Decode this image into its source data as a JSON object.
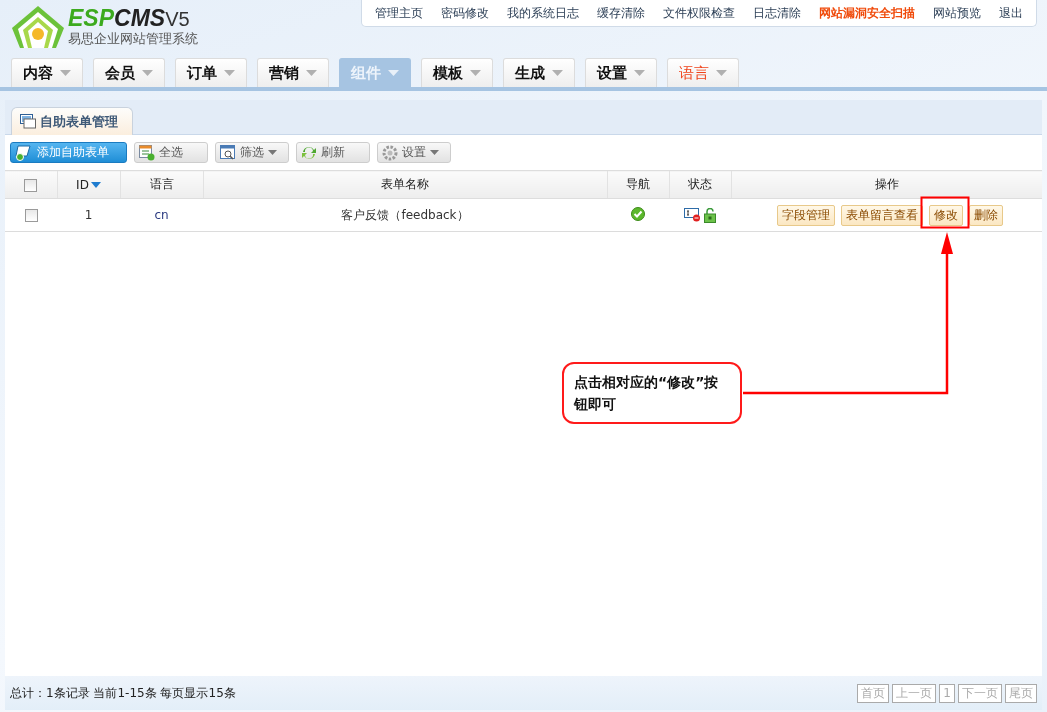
{
  "logo": {
    "brand_primary": "ESP",
    "brand_secondary": "CMS",
    "version": "V5",
    "subtitle": "易思企业网站管理系统"
  },
  "top_links": [
    {
      "label": "管理主页",
      "highlighted": false
    },
    {
      "label": "密码修改",
      "highlighted": false
    },
    {
      "label": "我的系统日志",
      "highlighted": false
    },
    {
      "label": "缓存清除",
      "highlighted": false
    },
    {
      "label": "文件权限检查",
      "highlighted": false
    },
    {
      "label": "日志清除",
      "highlighted": false
    },
    {
      "label": "网站漏洞安全扫描",
      "highlighted": true
    },
    {
      "label": "网站预览",
      "highlighted": false
    },
    {
      "label": "退出",
      "highlighted": false
    }
  ],
  "nav_tabs": [
    {
      "label": "内容",
      "selected": false,
      "highlighted": false
    },
    {
      "label": "会员",
      "selected": false,
      "highlighted": false
    },
    {
      "label": "订单",
      "selected": false,
      "highlighted": false
    },
    {
      "label": "营销",
      "selected": false,
      "highlighted": false
    },
    {
      "label": "组件",
      "selected": true,
      "highlighted": false
    },
    {
      "label": "模板",
      "selected": false,
      "highlighted": false
    },
    {
      "label": "生成",
      "selected": false,
      "highlighted": false
    },
    {
      "label": "设置",
      "selected": false,
      "highlighted": false
    },
    {
      "label": "语言",
      "selected": false,
      "highlighted": true
    }
  ],
  "panel_tab": {
    "label": "自助表单管理"
  },
  "toolbar": [
    {
      "label": "添加自助表单",
      "kind": "primary",
      "dropdown": false
    },
    {
      "label": "全选",
      "kind": "plain",
      "dropdown": false
    },
    {
      "label": "筛选",
      "kind": "plain",
      "dropdown": true
    },
    {
      "label": "刷新",
      "kind": "plain",
      "dropdown": false
    },
    {
      "label": "设置",
      "kind": "plain",
      "dropdown": true
    }
  ],
  "table": {
    "select_all": {
      "checked": false
    },
    "columns": [
      {
        "label": "ID",
        "sorted": true
      },
      {
        "label": "语言"
      },
      {
        "label": "表单名称"
      },
      {
        "label": "导航"
      },
      {
        "label": "状态"
      },
      {
        "label": "操作"
      }
    ],
    "rows": [
      {
        "checked": false,
        "id": "1",
        "language": "cn",
        "name": "客户反馈（feedback）",
        "nav_enabled": true,
        "actions": [
          "字段管理",
          "表单留言查看",
          "修改",
          "删除"
        ]
      }
    ]
  },
  "footer": {
    "summary": "总计：1条记录 当前1-15条 每页显示15条",
    "pager": [
      "首页",
      "上一页",
      "1",
      "下一页",
      "尾页"
    ]
  },
  "annotation": {
    "text": "点击相对应的“修改”按钮即可"
  }
}
